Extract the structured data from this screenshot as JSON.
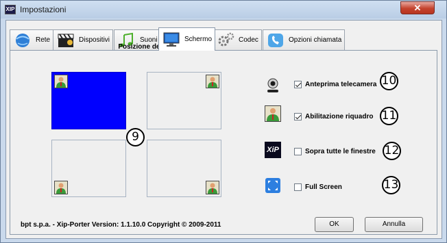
{
  "window": {
    "title": "Impostazioni",
    "app_icon_text": "XIP",
    "close_glyph": "✕"
  },
  "tabs": [
    {
      "label": "Rete",
      "icon": "globe-icon"
    },
    {
      "label": "Dispositivi",
      "icon": "clapperboard-icon"
    },
    {
      "label": "Suoni",
      "icon": "music-note-icon"
    },
    {
      "label": "Schermo",
      "icon": "monitor-icon",
      "active": true
    },
    {
      "label": "Codec",
      "icon": "gears-icon"
    },
    {
      "label": "Opzioni chiamata",
      "icon": "phone-icon"
    }
  ],
  "preview": {
    "title": "Posizione del riquadro",
    "selected_quadrant": "top-left",
    "quadrants": [
      "top-left",
      "top-right",
      "bottom-left",
      "bottom-right"
    ]
  },
  "callouts": {
    "preview": "9",
    "webcam": "10",
    "inset": "11",
    "on_top": "12",
    "fullscreen": "13"
  },
  "options": [
    {
      "label": "Anteprima telecamera",
      "checked": true,
      "icon": "webcam-icon"
    },
    {
      "label": "Abilitazione riquadro",
      "checked": true,
      "icon": "person-icon"
    },
    {
      "label": "Sopra tutte le finestre",
      "checked": false,
      "icon": "xip-logo-icon"
    },
    {
      "label": "Full Screen",
      "checked": false,
      "icon": "fullscreen-icon"
    }
  ],
  "footer": {
    "info": "bpt s.p.a. - Xip-Porter   Version: 1.1.10.0   Copyright © 2009-2011",
    "ok_label": "OK",
    "cancel_label": "Annulla"
  },
  "colors": {
    "selected_quadrant": "#0000ff",
    "close_button": "#c4432e"
  },
  "xip_logo_text": "XiP"
}
